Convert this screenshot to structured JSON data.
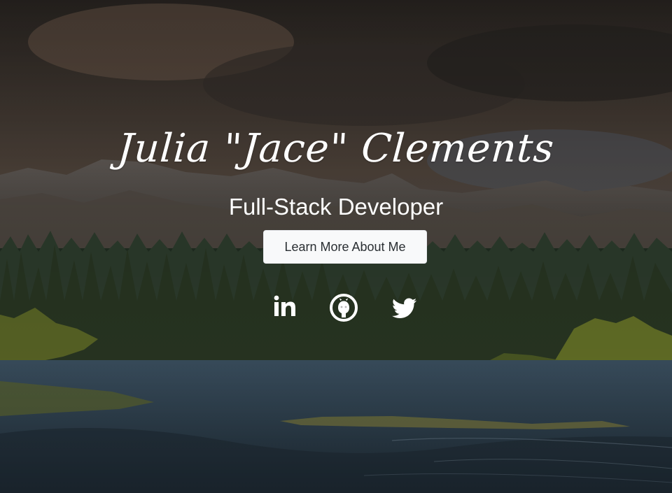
{
  "hero": {
    "name": "Julia \"Jace\" Clements",
    "subtitle": "Full-Stack Developer",
    "cta_label": "Learn More About Me"
  },
  "social_links": [
    {
      "name": "linkedin",
      "icon": "linkedin-icon"
    },
    {
      "name": "github",
      "icon": "github-icon"
    },
    {
      "name": "twitter",
      "icon": "twitter-icon"
    }
  ],
  "colors": {
    "text": "#ffffff",
    "button_background": "#f8f9fa",
    "button_text": "#2a2f33",
    "overlay": "#000000"
  }
}
